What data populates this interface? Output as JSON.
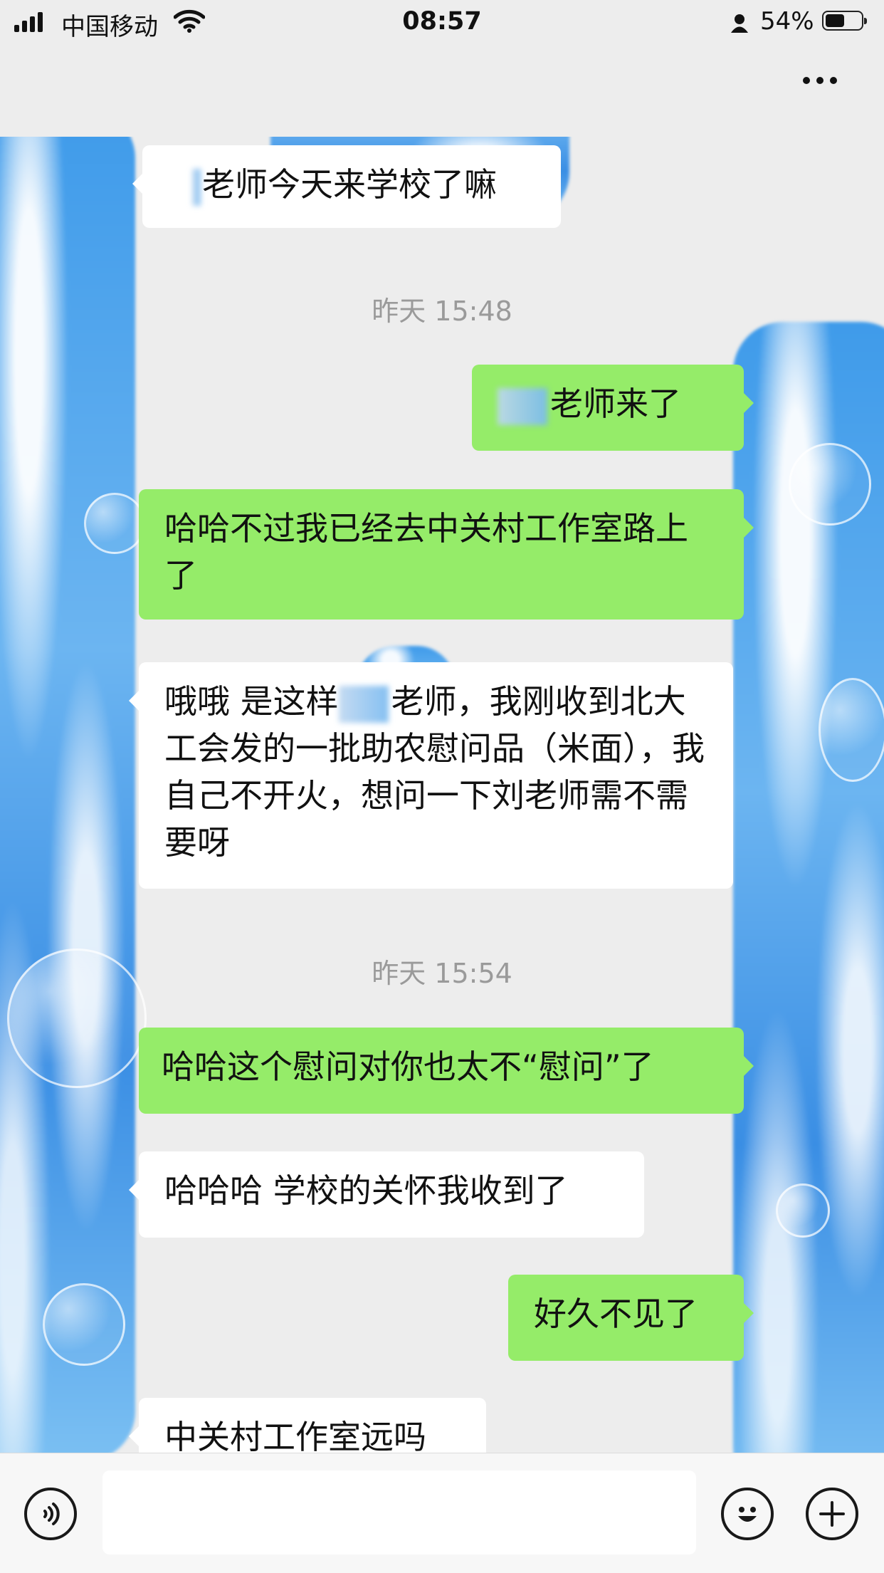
{
  "status_bar": {
    "carrier": "中国移动",
    "time": "08:57",
    "battery_percent": "54%",
    "battery_level": 0.54
  },
  "nav": {
    "title": "",
    "more_icon": "more-dots-icon"
  },
  "messages": [
    {
      "type": "in",
      "masked": "bar",
      "text": "老师今天来学校了嘛"
    },
    {
      "type": "time",
      "text": "昨天 15:48"
    },
    {
      "type": "out",
      "masked": "prefix",
      "text": "老师来了"
    },
    {
      "type": "out",
      "text": "哈哈不过我已经去中关村工作室路上了"
    },
    {
      "type": "in",
      "masked": "middle",
      "text_before": "哦哦 是这样",
      "text_after": "老师，我刚收到北大工会发的一批助农慰问品（米面），我自己不开火，想问一下刘老师需不需要呀"
    },
    {
      "type": "time",
      "text": "昨天 15:54"
    },
    {
      "type": "out",
      "text": "哈哈这个慰问对你也太不“慰问”了"
    },
    {
      "type": "in",
      "text": "哈哈哈 学校的关怀我收到了"
    },
    {
      "type": "out",
      "text": "好久不见了"
    },
    {
      "type": "in",
      "text": "中关村工作室远吗"
    }
  ],
  "input_bar": {
    "voice_icon": "voice-icon",
    "emoji_icon": "emoji-icon",
    "plus_icon": "plus-icon",
    "value": ""
  },
  "colors": {
    "outgoing_bubble": "#95ec69",
    "incoming_bubble": "#ffffff",
    "background": "#ededed",
    "timestamp": "#9a9a9a"
  }
}
